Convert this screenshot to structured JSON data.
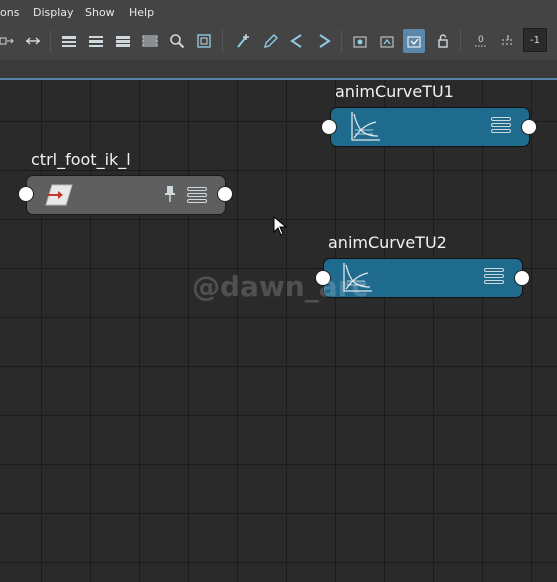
{
  "menu": {
    "items": [
      {
        "label": "ons"
      },
      {
        "label": "Display"
      },
      {
        "label": "Show"
      },
      {
        "label": "Help"
      }
    ]
  },
  "toolbar": {
    "field_value": "-1",
    "buttons": [
      "connections-icon",
      "arrows-icon",
      "layout-list-icon",
      "layout-list-2-icon",
      "layout-list-3-icon",
      "layout-list-4-icon",
      "search-icon",
      "frame-icon",
      "add-node-icon",
      "edit-node-icon",
      "graph-up-icon",
      "graph-down-icon",
      "graph-selected-icon",
      "graph-settings-icon",
      "graph-active-icon",
      "lock-icon",
      "zero-icon",
      "nudge-icon"
    ]
  },
  "colors": {
    "anim_node": "#1f6b8e",
    "ctrl_node": "#5f5f5f",
    "canvas": "#2a2a2a",
    "grid_line": "#1c1c1c",
    "accent": "#5d87a8"
  },
  "nodes": {
    "anim1": {
      "label": "animCurveTU1"
    },
    "anim2": {
      "label": "animCurveTU2"
    },
    "ctrl": {
      "label": "ctrl_foot_ik_l"
    }
  },
  "watermark": {
    "text": "@dawn_arc"
  }
}
